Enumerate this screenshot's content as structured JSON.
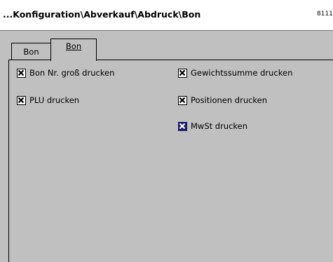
{
  "window": {
    "title": "...Konfiguration\\Abverkauf\\Abdruck\\Bon",
    "code": "8111"
  },
  "tabs": [
    {
      "label": "Bon",
      "active": false
    },
    {
      "label": "Bon",
      "active": true
    }
  ],
  "options": [
    {
      "label": "Bon Nr. groß drucken",
      "checked": true,
      "focused": false
    },
    {
      "label": "PLU drucken",
      "checked": true,
      "focused": false
    },
    {
      "label": "Gewichtssumme drucken",
      "checked": true,
      "focused": false
    },
    {
      "label": "Positionen drucken",
      "checked": true,
      "focused": false
    },
    {
      "label": "MwSt drucken",
      "checked": true,
      "focused": true
    }
  ],
  "colors": {
    "background": "#c0c0c0",
    "titlebar": "#ffffff",
    "focus_checkbox": "#1a1a6a"
  }
}
